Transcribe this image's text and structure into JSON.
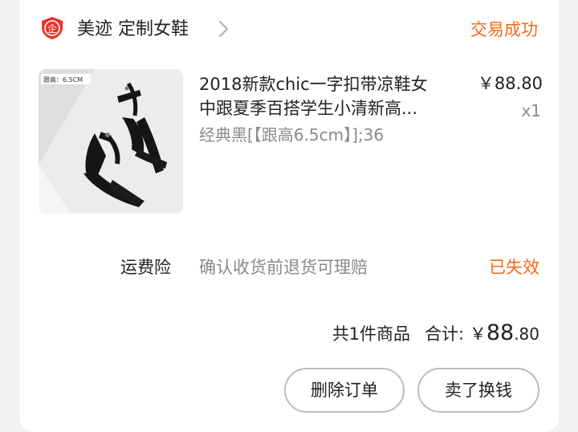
{
  "shop": {
    "logo_icon": "shop-badge-icon",
    "logo_text": "企",
    "name": "美迹 定制女鞋",
    "chevron_icon": "chevron-right-icon"
  },
  "order": {
    "status": "交易成功"
  },
  "product": {
    "thumbnail_caption": "跟高：6.5CM",
    "title_line1": "2018新款chic一字扣带凉鞋女",
    "title_line2": "中跟夏季百搭学生小清新高...",
    "spec": "经典黑[【跟高6.5cm】];36",
    "price": "￥88.80",
    "quantity": "x1"
  },
  "insurance": {
    "label": "运费险",
    "description": "确认收货前退货可理赔",
    "status": "已失效"
  },
  "summary": {
    "count_text": "共1件商品",
    "total_label": "合计:",
    "currency": "￥",
    "total_int": "88",
    "total_dec": ".80"
  },
  "actions": {
    "delete_label": "删除订单",
    "sell_label": "卖了换钱"
  },
  "colors": {
    "accent_orange": "#f56a1a",
    "logo_red": "#e8342a",
    "muted_text": "#8a8a8a"
  }
}
